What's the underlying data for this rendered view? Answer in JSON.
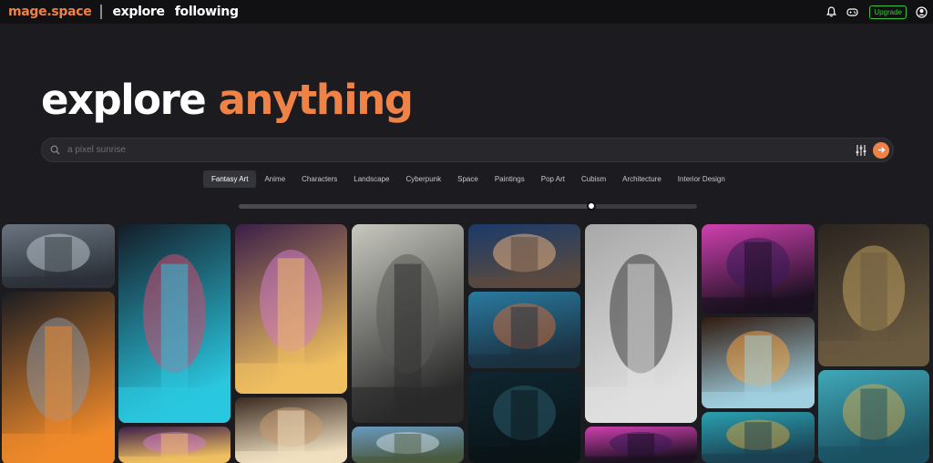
{
  "nav": {
    "logo": "mage.space",
    "links": [
      "explore",
      "following"
    ],
    "upgrade_label": "Upgrade",
    "icons": [
      "bell-icon",
      "gamepad-icon",
      "account-icon"
    ]
  },
  "hero": {
    "title_white": "explore",
    "title_orange": "anything"
  },
  "search": {
    "placeholder": "a pixel sunrise",
    "value": ""
  },
  "categories": [
    "Fantasy Art",
    "Anime",
    "Characters",
    "Landscape",
    "Cyberpunk",
    "Space",
    "Paintings",
    "Pop Art",
    "Cubism",
    "Architecture",
    "Interior Design"
  ],
  "selected_category": "Fantasy Art",
  "slider_level": 0.77,
  "colors": {
    "accent": "#ef8246",
    "background": "#1c1c20",
    "topbar": "#111114",
    "upgrade": "#3cc43c"
  },
  "gallery": [
    {
      "name": "tile-futuristic-city"
    },
    {
      "name": "tile-robot-headphones"
    },
    {
      "name": "tile-neon-street-motorbike"
    },
    {
      "name": "tile-portal-archway"
    },
    {
      "name": "tile-woman-portrait"
    },
    {
      "name": "tile-ruined-tower"
    },
    {
      "name": "tile-cathedral-spire"
    },
    {
      "name": "tile-space-sphere"
    },
    {
      "name": "tile-desert-spaceship"
    },
    {
      "name": "tile-dark-corridor"
    },
    {
      "name": "tile-lighthouse-tower-moon"
    },
    {
      "name": "tile-purple-tree"
    },
    {
      "name": "tile-neon-city-silhouettes"
    },
    {
      "name": "tile-fireworks-globe"
    },
    {
      "name": "tile-golden-arches"
    },
    {
      "name": "tile-steampunk-owl"
    },
    {
      "name": "tile-crystal-palace"
    }
  ]
}
